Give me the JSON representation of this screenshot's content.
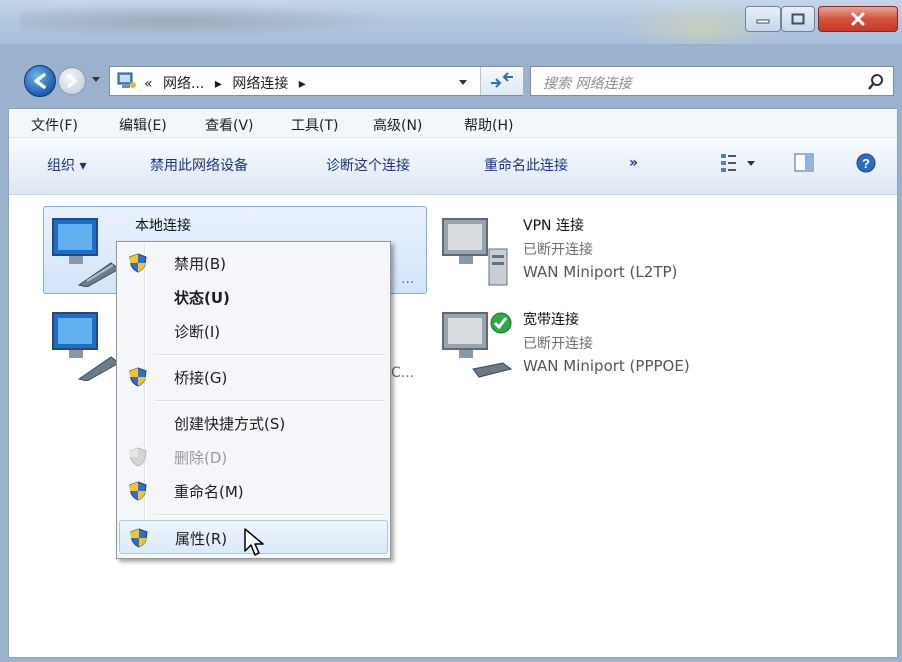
{
  "address": {
    "crumbs": [
      "«",
      "网络...",
      "▸",
      "网络连接",
      "▸"
    ]
  },
  "search": {
    "placeholder": "搜索 网络连接"
  },
  "menu": [
    "文件(F)",
    "编辑(E)",
    "查看(V)",
    "工具(T)",
    "高级(N)",
    "帮助(H)"
  ],
  "toolbar": {
    "organize": "组织 ▾",
    "disable": "禁用此网络设备",
    "diagnose": "诊断这个连接",
    "rename": "重命名此连接",
    "more": "»"
  },
  "connections": {
    "local": {
      "name": "本地连接",
      "trunc1": "...",
      "trunc2": "C..."
    },
    "vpn": {
      "name": "VPN 连接",
      "status": "已断开连接",
      "device": "WAN Miniport (L2TP)"
    },
    "broadband": {
      "name": "宽带连接",
      "status": "已断开连接",
      "device": "WAN Miniport (PPPOE)"
    }
  },
  "context_menu": {
    "disable": "禁用(B)",
    "status": "状态(U)",
    "diagnose": "诊断(I)",
    "bridge": "桥接(G)",
    "shortcut": "创建快捷方式(S)",
    "delete": "删除(D)",
    "rename": "重命名(M)",
    "properties": "属性(R)"
  },
  "colors": {
    "accent": "#1e3287",
    "highlight": "#dbe9f9",
    "close": "#c53a24"
  }
}
